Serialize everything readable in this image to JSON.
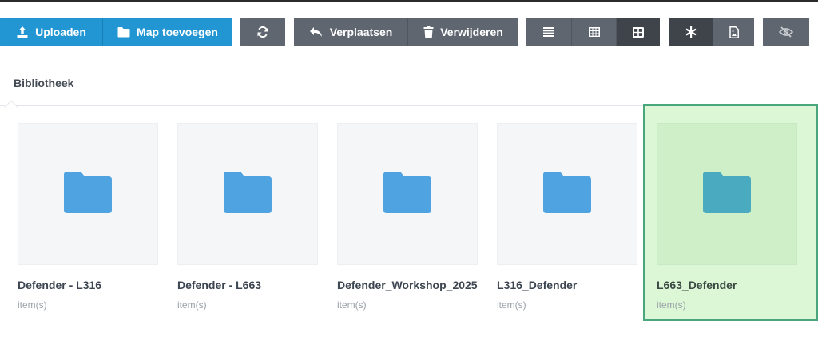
{
  "toolbar": {
    "upload_label": "Uploaden",
    "new_folder_label": "Map toevoegen",
    "move_label": "Verplaatsen",
    "delete_label": "Verwijderen",
    "icons": {
      "upload": "upload-icon",
      "new_folder": "folder-icon",
      "refresh": "refresh-icon",
      "move": "reply-icon",
      "delete": "trash-icon",
      "view_list": "list-icon",
      "view_grid_small": "grid-small-icon",
      "view_grid_large": "grid-large-icon",
      "asterisk": "asterisk-icon",
      "image_file": "image-file-icon",
      "hidden": "eye-slash-icon"
    },
    "colors": {
      "primary": "#2196d3",
      "secondary": "#5f6670",
      "active": "#3f444b"
    }
  },
  "breadcrumb": {
    "current": "Bibliotheek"
  },
  "folders": [
    {
      "name": "Defender - L316",
      "meta": "item(s)",
      "selected": false
    },
    {
      "name": "Defender - L663",
      "meta": "item(s)",
      "selected": false
    },
    {
      "name": "Defender_Workshop_2025",
      "meta": "item(s)",
      "selected": false
    },
    {
      "name": "L316_Defender",
      "meta": "item(s)",
      "selected": false
    },
    {
      "name": "L663_Defender",
      "meta": "item(s)",
      "selected": true
    }
  ],
  "colors": {
    "folder": "#4fa3e0",
    "folder_selected": "#4aaabf",
    "selection_bg": "#dcf7d6",
    "selection_border": "#4aa67c"
  }
}
